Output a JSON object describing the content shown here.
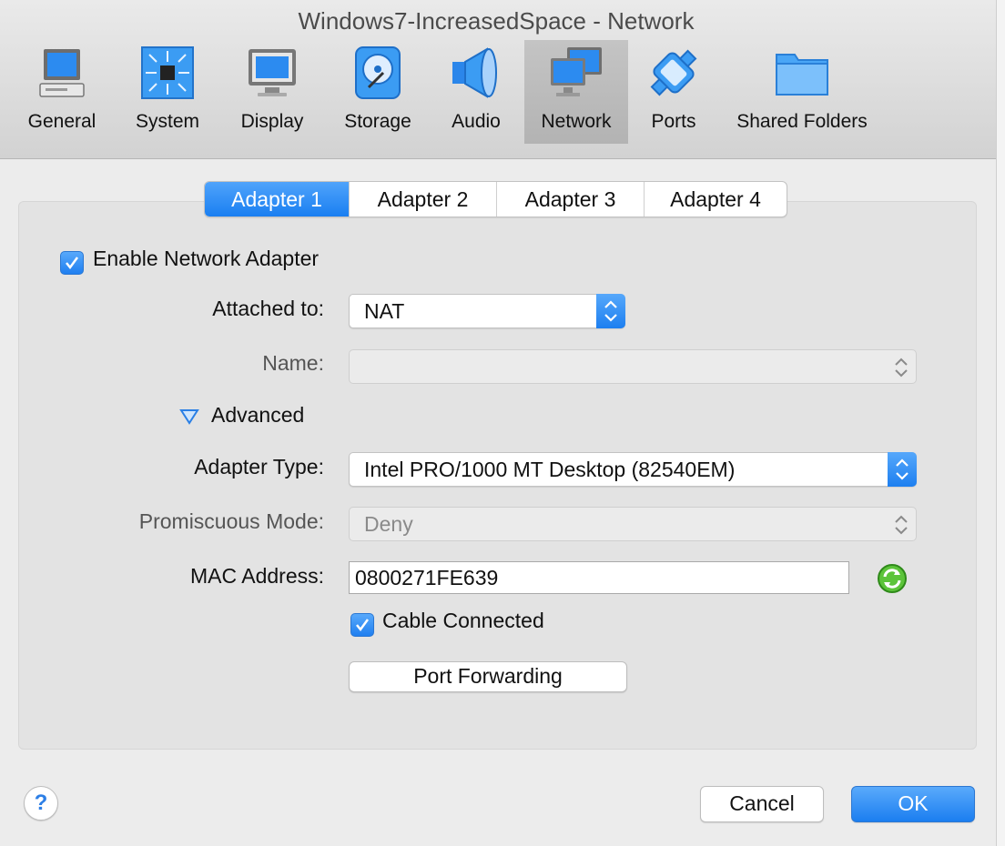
{
  "window": {
    "title": "Windows7-IncreasedSpace - Network"
  },
  "toolbar": {
    "items": [
      {
        "label": "General",
        "icon": "general-icon"
      },
      {
        "label": "System",
        "icon": "system-chip-icon"
      },
      {
        "label": "Display",
        "icon": "monitor-icon"
      },
      {
        "label": "Storage",
        "icon": "hard-disk-icon"
      },
      {
        "label": "Audio",
        "icon": "speaker-icon"
      },
      {
        "label": "Network",
        "icon": "network-icon",
        "selected": true
      },
      {
        "label": "Ports",
        "icon": "serial-port-icon"
      },
      {
        "label": "Shared Folders",
        "icon": "folder-icon"
      }
    ]
  },
  "tabs": [
    {
      "label": "Adapter 1",
      "active": true
    },
    {
      "label": "Adapter 2"
    },
    {
      "label": "Adapter 3"
    },
    {
      "label": "Adapter 4"
    }
  ],
  "adapter": {
    "enable_label": "Enable Network Adapter",
    "enable_checked": true,
    "attached_label": "Attached to:",
    "attached_value": "NAT",
    "name_label": "Name:",
    "name_value": "",
    "advanced_label": "Advanced",
    "adapter_type_label": "Adapter Type:",
    "adapter_type_value": "Intel PRO/1000 MT Desktop (82540EM)",
    "promiscuous_label": "Promiscuous Mode:",
    "promiscuous_value": "Deny",
    "mac_label": "MAC Address:",
    "mac_value": "0800271FE639",
    "cable_label": "Cable Connected",
    "cable_checked": true,
    "port_forwarding_label": "Port Forwarding"
  },
  "footer": {
    "help_label": "?",
    "cancel_label": "Cancel",
    "ok_label": "OK"
  },
  "colors": {
    "accent": "#1f80f0",
    "toolbar_bg": "#dcdcdc",
    "panel_bg": "#e3e3e3"
  }
}
